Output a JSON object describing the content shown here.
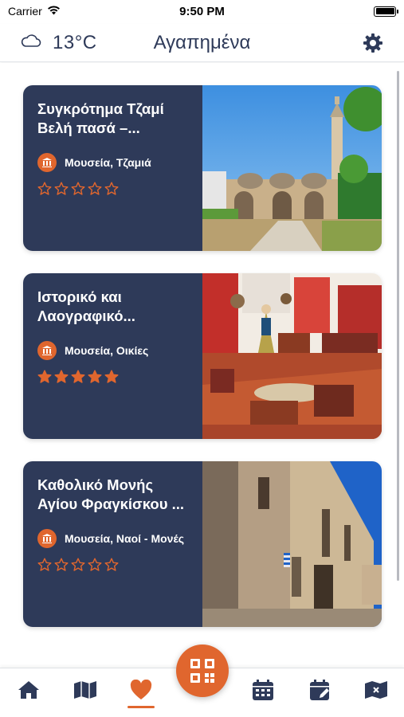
{
  "status_bar": {
    "carrier": "Carrier",
    "time": "9:50 PM"
  },
  "header": {
    "temperature": "13°C",
    "title": "Αγαπημένα",
    "weather_icon": "cloud-icon",
    "settings_icon": "gear-icon"
  },
  "favorites": [
    {
      "title": "Συγκρότημα Τζαμί Βελή πασά –...",
      "category": "Μουσεία, Τζαμιά",
      "rating": 0,
      "max_rating": 5
    },
    {
      "title": "Ιστορικό και Λαογραφικό...",
      "category": "Μουσεία, Οικίες",
      "rating": 5,
      "max_rating": 5
    },
    {
      "title": "Καθολικό Μονής Αγίου Φραγκίσκου ...",
      "category": "Μουσεία, Ναοί - Μονές",
      "rating": 0,
      "max_rating": 5
    }
  ],
  "bottom_nav": {
    "items": [
      "home-icon",
      "map-icon",
      "heart-icon",
      "calendar-icon",
      "calendar-edit-icon",
      "map-close-icon"
    ],
    "active": "heart-icon",
    "center_button": "qr-grid-icon"
  },
  "colors": {
    "primary": "#2e3a59",
    "accent": "#e0662e",
    "background": "#ffffff"
  }
}
